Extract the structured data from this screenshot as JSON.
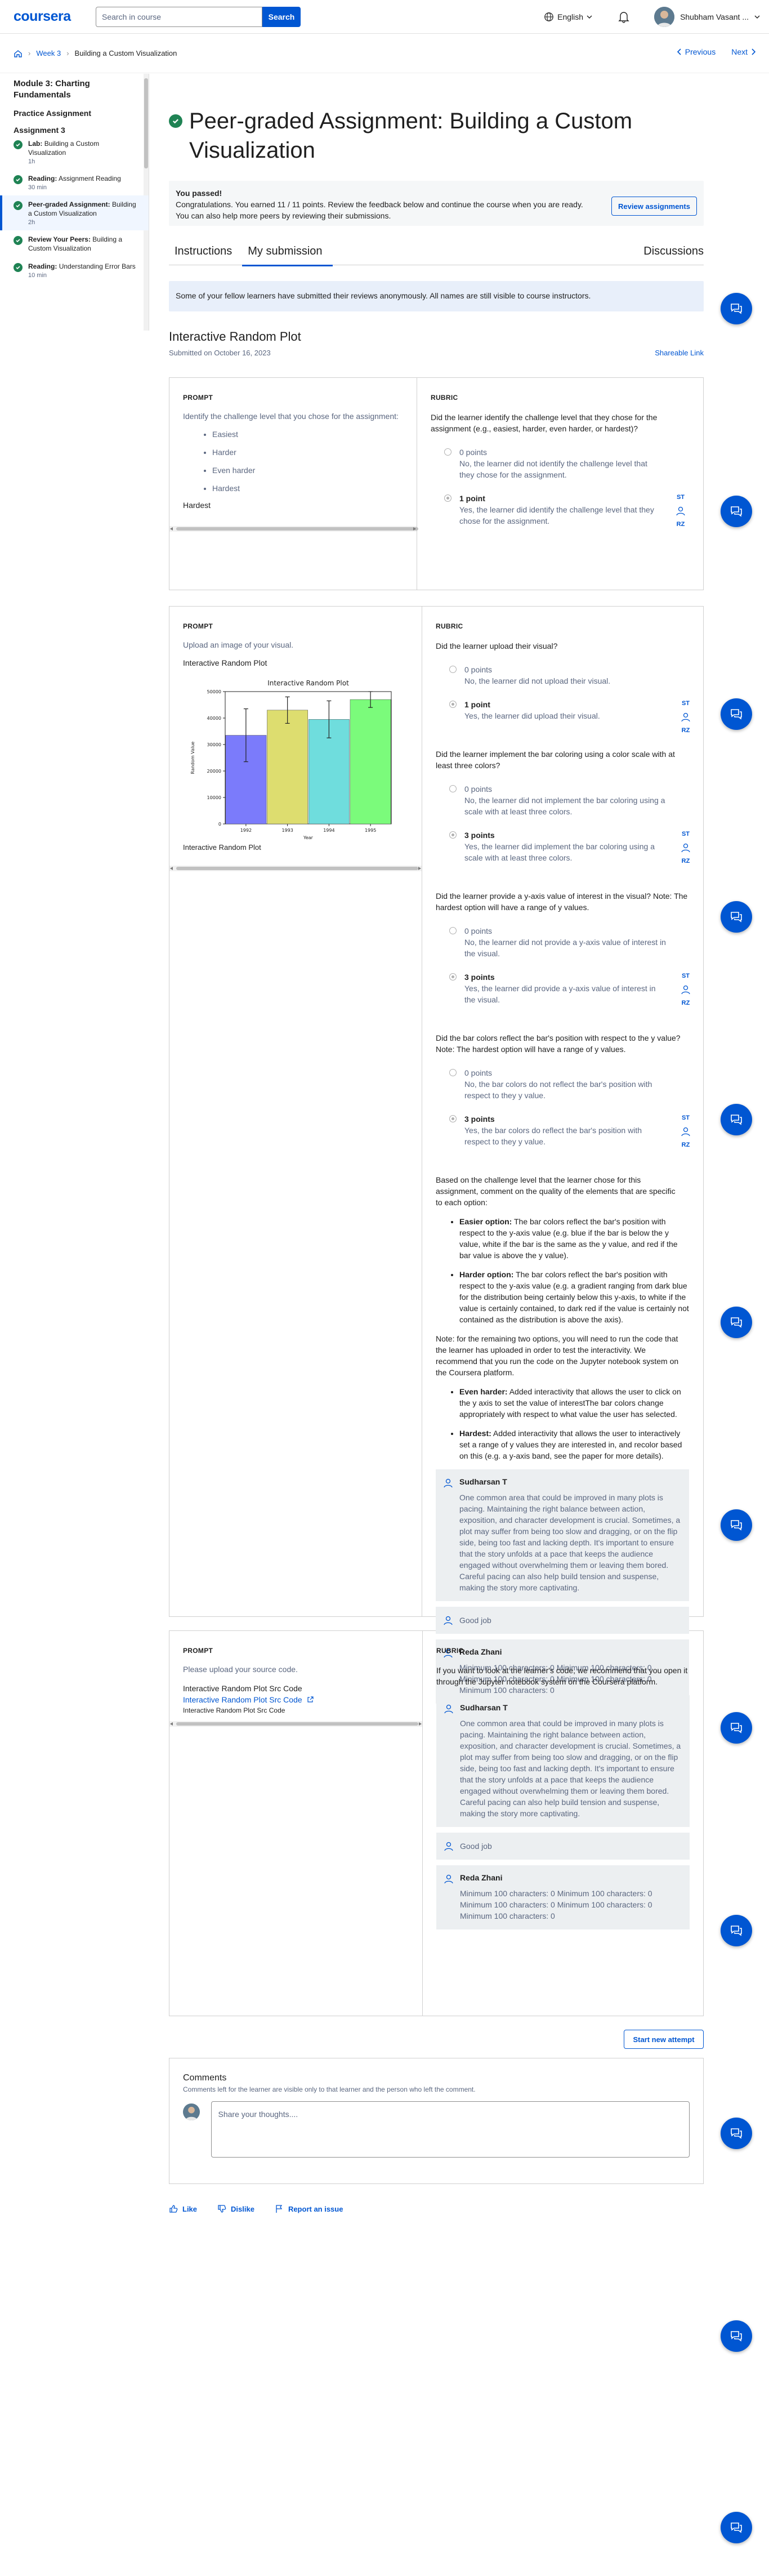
{
  "header": {
    "logo": "coursera",
    "search_placeholder": "Search in course",
    "search_button": "Search",
    "language": "English",
    "user_name": "Shubham Vasant ..."
  },
  "breadcrumb": {
    "items": [
      "Week 3",
      "Building a Custom Visualization"
    ],
    "previous": "Previous",
    "next": "Next"
  },
  "sidebar": {
    "module": "Module 3: Charting Fundamentals",
    "section1": "Practice Assignment",
    "section2": "Assignment 3",
    "items": [
      {
        "type": "Lab:",
        "title": "Building a Custom Visualization",
        "dur": "1h"
      },
      {
        "type": "Reading:",
        "title": "Assignment Reading",
        "dur": "30 min"
      },
      {
        "type": "Peer-graded Assignment:",
        "title": "Building a Custom Visualization",
        "dur": "2h"
      },
      {
        "type": "Review Your Peers:",
        "title": "Building a Custom Visualization",
        "dur": ""
      },
      {
        "type": "Reading:",
        "title": "Understanding Error Bars",
        "dur": "10 min"
      }
    ]
  },
  "page": {
    "title": "Peer-graded Assignment: Building a Custom Visualization",
    "passed_title": "You passed!",
    "passed_text": "Congratulations. You earned 11 / 11 points. Review the feedback below and continue the course when you are ready. You can also help more peers by reviewing their submissions.",
    "review_button": "Review assignments",
    "tabs": [
      "Instructions",
      "My submission",
      "Discussions"
    ],
    "anon_notice": "Some of your fellow learners have submitted their reviews anonymously. All names are still visible to course instructors.",
    "submission_title": "Interactive Random Plot",
    "submitted_on": "Submitted on October 16, 2023",
    "shareable_link": "Shareable Link"
  },
  "labels": {
    "prompt": "PROMPT",
    "rubric": "RUBRIC",
    "reviewer1": "ST",
    "reviewer2": "RZ"
  },
  "section1": {
    "prompt": "Identify the challenge level that you chose for the assignment:",
    "levels": [
      "Easiest",
      "Harder",
      "Even harder",
      "Hardest"
    ],
    "answer": "Hardest",
    "question": "Did the learner identify the challenge level that they chose for the assignment (e.g., easiest, harder, even harder, or hardest)?",
    "opt0_pts": "0 points",
    "opt0_text": "No, the learner did not identify the challenge level that they chose for the assignment.",
    "opt1_pts": "1 point",
    "opt1_text": "Yes, the learner did identify the challenge level that they chose for the assignment."
  },
  "section2": {
    "prompt": "Upload an image of your visual.",
    "image_caption": "Interactive Random Plot",
    "image_caption2": "Interactive Random Plot",
    "q1": "Did the learner upload their visual?",
    "q1o0p": "0 points",
    "q1o0t": "No, the learner did not upload their visual.",
    "q1o1p": "1 point",
    "q1o1t": "Yes, the learner did upload their visual.",
    "q2": "Did the learner implement the bar coloring using a color scale with at least three colors?",
    "q2o0p": "0 points",
    "q2o0t": "No, the learner did not implement the bar coloring using a scale with at least three colors.",
    "q2o1p": "3 points",
    "q2o1t": "Yes, the learner did implement the bar coloring using a scale with at least three colors.",
    "q3": "Did the learner provide a y-axis value of interest in the visual? Note: The hardest option will have a range of y values.",
    "q3o0p": "0 points",
    "q3o0t": "No, the learner did not provide a y-axis value of interest in the visual.",
    "q3o1p": "3 points",
    "q3o1t": "Yes, the learner did provide a y-axis value of interest in the visual.",
    "q4": "Did the bar colors reflect the bar's position with respect to the y value? Note: The hardest option will have a range of y values.",
    "q4o0p": "0 points",
    "q4o0t": "No, the bar colors do not reflect the bar's position with respect to they y value.",
    "q4o1p": "3 points",
    "q4o1t": "Yes, the bar colors do reflect the bar's position with respect to they y value.",
    "feedback_intro": "Based on the challenge level that the learner chose for this assignment, comment on the quality of the elements that are specific to each option:",
    "easier_label": "Easier option:",
    "easier_text": " The bar colors reflect the bar's position with respect to the y-axis value (e.g. blue if the bar is below the y value, white if the bar is the same as the y value, and red if the bar value is above the y value).",
    "harder_label": "Harder option:",
    "harder_text": " The bar colors reflect the bar's position with respect to the y-axis value (e.g. a gradient ranging from dark blue for the distribution being certainly below this y-axis, to white if the value is certainly contained, to dark red if the value is certainly not contained as the distribution is above the axis).",
    "note": "Note: for the remaining two options, you will need to run the code that the learner has uploaded in order to test the interactivity. We recommend that you run the code on the Jupyter notebook system on the Coursera platform.",
    "evenharder_label": "Even harder:",
    "evenharder_text": " Added interactivity that allows the user to click on the y axis to set the value of interestThe bar colors change appropriately with respect to what value the user has selected.",
    "hardest_label": "Hardest:",
    "hardest_text": " Added interactivity that allows the user to interactively set a range of y values they are interested in, and recolor based on this (e.g. a y-axis band, see the paper for more details)."
  },
  "section3": {
    "prompt": "Please upload your source code.",
    "code_label": "Interactive Random Plot Src Code",
    "code_link": "Interactive Random Plot Src Code",
    "code_caption": "Interactive Random Plot Src Code",
    "rubric_text": "If you want to look at the learner's code, we recommend that you open it through the Jupyter notebook system on the Coursera platform."
  },
  "comments": {
    "c1_name": "Sudharsan T",
    "c1_text": "One common area that could be improved in many plots is pacing. Maintaining the right balance between action, exposition, and character development is crucial. Sometimes, a plot may suffer from being too slow and dragging, or on the flip side, being too fast and lacking depth. It's important to ensure that the story unfolds at a pace that keeps the audience engaged without overwhelming them or leaving them bored. Careful pacing can also help build tension and suspense, making the story more captivating.",
    "c2_text": "Good job",
    "c3_name": "Reda Zhani",
    "c3_text": "Minimum 100 characters: 0 Minimum 100 characters: 0 Minimum 100 characters: 0 Minimum 100 characters: 0 Minimum 100 characters: 0"
  },
  "footer": {
    "start_new": "Start new attempt",
    "comments_title": "Comments",
    "comments_sub": "Comments left for the learner are visible only to that learner and the person who left the comment.",
    "placeholder": "Share your thoughts....",
    "like": "Like",
    "dislike": "Dislike",
    "report": "Report an issue"
  },
  "chart_data": {
    "type": "bar",
    "title": "Interactive Random Plot",
    "xlabel": "Year",
    "ylabel": "Random Value",
    "categories": [
      "1992",
      "1993",
      "1994",
      "1995"
    ],
    "values": [
      33500,
      43000,
      39500,
      47000
    ],
    "errors": [
      10000,
      5000,
      7000,
      3000
    ],
    "ylim": [
      0,
      50000
    ],
    "yticks": [
      0,
      10000,
      20000,
      30000,
      40000,
      50000
    ],
    "colors": [
      "#7b7bfb",
      "#dddd6f",
      "#6fdddd",
      "#7bfb7b"
    ]
  }
}
